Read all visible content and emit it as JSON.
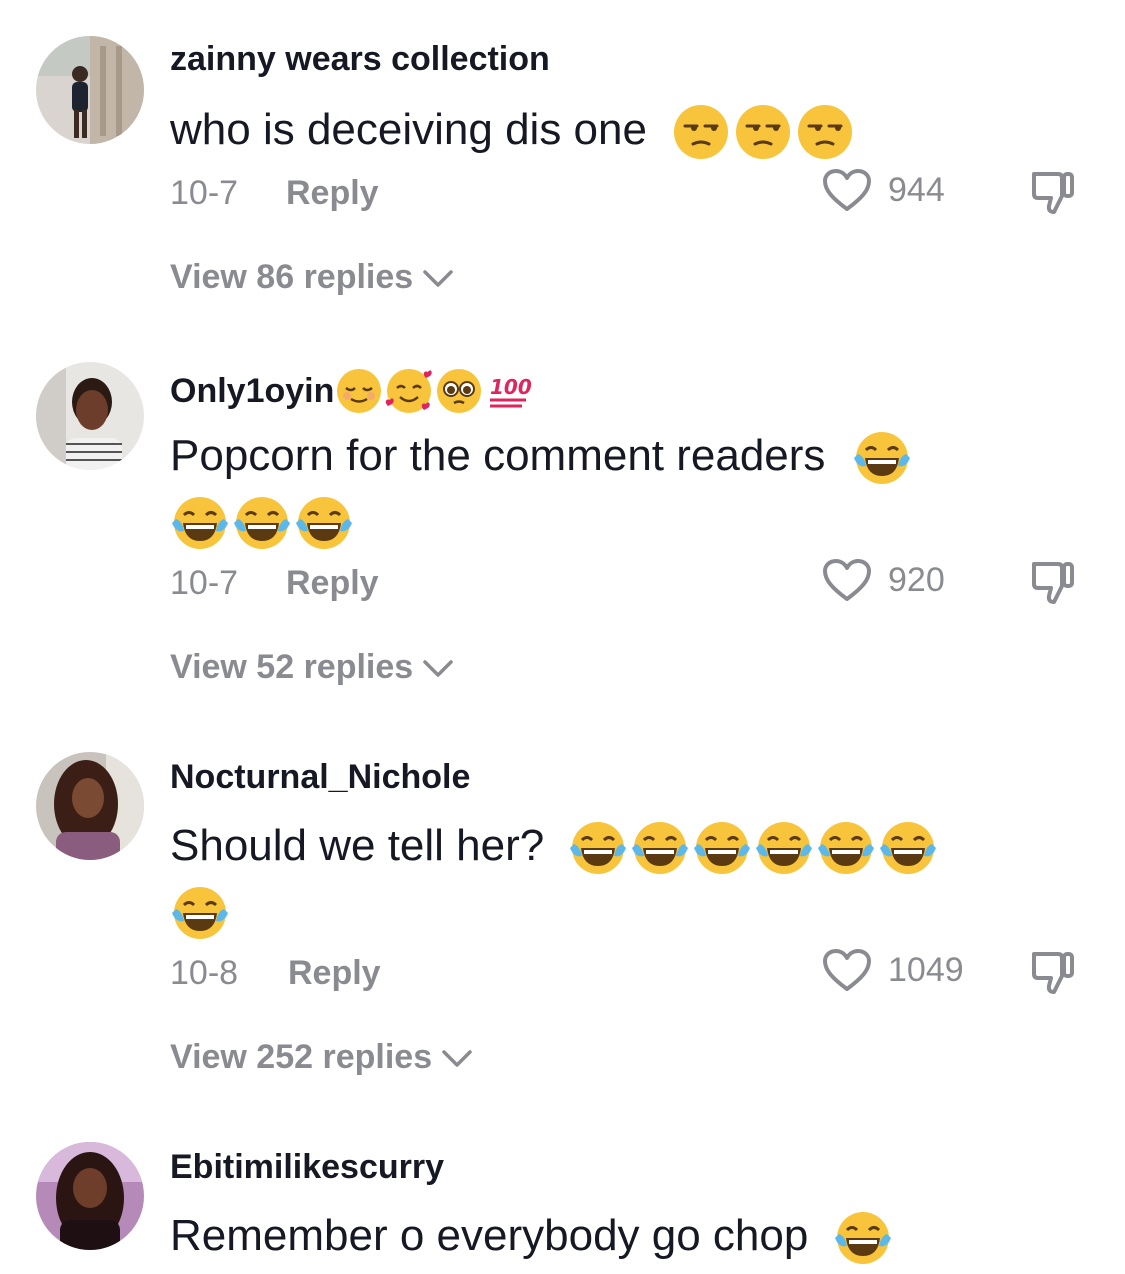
{
  "comments": [
    {
      "username": "zainny wears collection",
      "username_emojis": [],
      "text": "who is deceiving dis one",
      "text_emojis": [
        "unamused-face",
        "unamused-face",
        "unamused-face"
      ],
      "date": "10-7",
      "reply_label": "Reply",
      "likes": "944",
      "view_replies": "View 86 replies"
    },
    {
      "username": "Only1oyin",
      "username_emojis": [
        "relieved-face",
        "smiling-face-with-hearts",
        "pleading-face",
        "hundred-points"
      ],
      "text": "Popcorn for the comment readers",
      "text_emojis": [
        "tears-of-joy",
        "tears-of-joy",
        "tears-of-joy",
        "tears-of-joy"
      ],
      "date": "10-7",
      "reply_label": "Reply",
      "likes": "920",
      "view_replies": "View 52 replies"
    },
    {
      "username": "Nocturnal_Nichole",
      "username_emojis": [],
      "text": "Should we tell her?",
      "text_emojis": [
        "tears-of-joy",
        "tears-of-joy",
        "tears-of-joy",
        "tears-of-joy",
        "tears-of-joy",
        "tears-of-joy",
        "tears-of-joy"
      ],
      "date": "10-8",
      "reply_label": "Reply",
      "likes": "1049",
      "view_replies": "View 252 replies"
    },
    {
      "username": "Ebitimilikescurry",
      "username_emojis": [],
      "text": "Remember o everybody go chop",
      "text_emojis": [
        "tears-of-joy"
      ]
    }
  ],
  "colors": {
    "primary_text": "#161823",
    "secondary_text": "#8a8b91",
    "background": "#ffffff"
  }
}
